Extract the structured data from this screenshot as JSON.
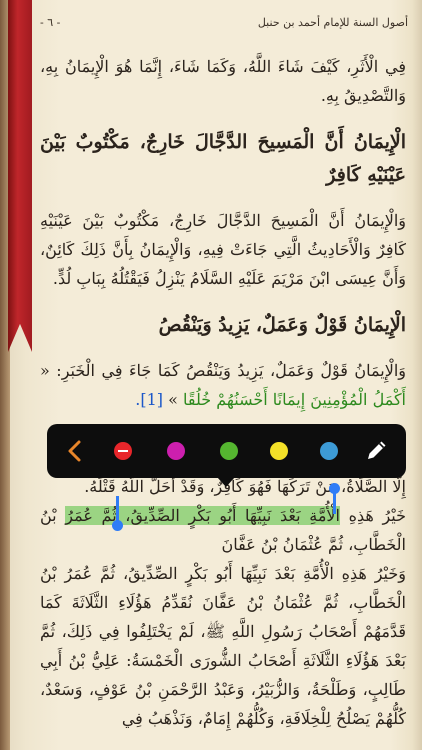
{
  "header": {
    "book_title": "أصول السنة للإمام أحمد بن حنبل",
    "page_label": "- ٦ -"
  },
  "content": {
    "p1": "فِي الْأَثَرِ، كَيْفَ شَاءَ اللَّهُ، وَكَمَا شَاءَ، إِنَّمَا هُوَ الْإِيمَانُ بِهِ، وَالتَّصْدِيقُ بِهِ.",
    "h1": "الْإِيمَانُ أَنَّ الْمَسِيحَ الدَّجَّالَ خَارِجٌ، مَكْتُوبٌ بَيْنَ عَيْنَيْهِ كَافِرٌ",
    "p2": "وَالْإِيمَانُ أَنَّ الْمَسِيحَ الدَّجَّالَ خَارِجٌ، مَكْتُوبٌ بَيْنَ عَيْنَيْهِ كَافِرٌ وَالْأَحَادِيثُ الَّتِي جَاءَتْ فِيهِ، وَالْإِيمَانُ بِأَنَّ ذَلِكَ كَائِنٌ، وَأَنَّ عِيسَى ابْنَ مَرْيَمَ عَلَيْهِ السَّلَامُ يَنْزِلُ فَيَقْتُلُهُ بِبَابِ لُدٍّ.",
    "h2": "الْإِيمَانُ قَوْلٌ وَعَمَلٌ، يَزِيدُ وَيَنْقُصُ",
    "p3_start": "وَالْإِيمَانُ قَوْلٌ وَعَمَلٌ، يَزِيدُ وَيَنْقُصُ كَمَا جَاءَ فِي الْخَبَرِ: «",
    "p3_verse": "أَكْمَلُ الْمُؤْمِنِينَ إِيمَانًا أَحْسَنُهُمْ خُلُقًا",
    "p3_end": "»",
    "p3_footnote": "[1].",
    "p4": "إِلَّا الصَّلَاةُ، مَنْ تَرَكَهَا فَهُوَ كَافِرٌ، وَقَدْ أَحَلَّ اللَّهُ قَتْلَهُ.",
    "p5_start": "خَيْرُ هَذِهِ ",
    "p5_selected": "الْأُمَّةِ بَعْدَ نَبِيِّهَا أَبُو بَكْرٍ الصِّدِّيقُ، ثُمَّ عُمَرُ",
    "p5_end": " بْنُ الْخَطَّابِ، ثُمَّ عُثْمَانُ بْنُ عَفَّانَ",
    "p6": "وَخَيْرُ هَذِهِ الْأُمَّةِ بَعْدَ نَبِيِّهَا أَبُو بَكْرٍ الصِّدِّيقُ، ثُمَّ عُمَرُ بْنُ الْخَطَّابِ، ثُمَّ عُثْمَانُ بْنُ عَفَّانَ نُقَدِّمُ هَؤُلَاءِ الثَّلَاثَةَ كَمَا قَدَّمَهُمْ أَصْحَابُ رَسُولِ اللَّهِ ﷺ، لَمْ يَخْتَلِفُوا فِي ذَلِكَ، ثُمَّ بَعْدَ هَؤُلَاءِ الثَّلَاثَةِ أَصْحَابُ الشُّورَى الْخَمْسَةُ: عَلِيُّ بْنُ أَبِي طَالِبٍ، وَطَلْحَةُ، وَالزُّبَيْرُ، وَعَبْدُ الرَّحْمَنِ بْنُ عَوْفٍ، وَسَعْدٌ، كُلُّهُمْ يَصْلُحُ لِلْخِلَافَةِ، وَكُلُّهُمْ إِمَامٌ، وَنَذْهَبُ فِي"
  },
  "toolbar": {
    "icons": [
      "chevron-left-icon",
      "remove-highlight-icon",
      "pencil-icon"
    ],
    "colors": {
      "red": "#e8262b",
      "magenta": "#cc1fae",
      "green": "#55b630",
      "yellow": "#f4e128",
      "blue": "#3d9bd6"
    }
  },
  "colors": {
    "ribbon": "#c0262b",
    "paper": "#f4ecd8",
    "verse": "#2d8a1e",
    "footnote": "#1b57c9",
    "selection": "#9bd483",
    "selection_handle": "#2f7cf6"
  }
}
